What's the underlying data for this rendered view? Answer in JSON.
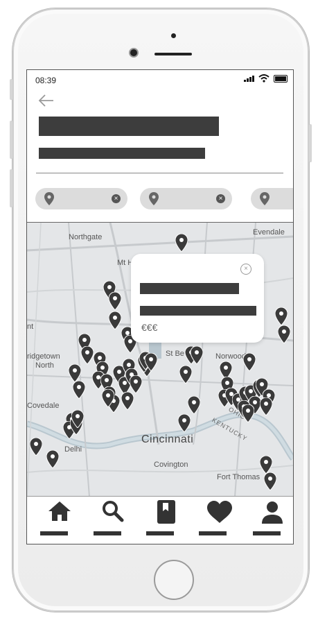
{
  "status_bar": {
    "time": "08:39"
  },
  "header": {
    "back_icon": "arrow-left-icon"
  },
  "filter_chips": [
    {
      "icon": "location-pin-icon",
      "remove_icon": "close-icon",
      "remove_symbol": "×"
    },
    {
      "icon": "location-pin-icon",
      "remove_icon": "close-icon",
      "remove_symbol": "×"
    },
    {
      "icon": "location-pin-icon"
    }
  ],
  "map": {
    "labels": {
      "northgate": "Northgate",
      "evendale": "Evendale",
      "mt_h": "Mt H",
      "nt": "nt",
      "bridgetown": "ridgetown",
      "north": "North",
      "st_be": "St Be",
      "norwood": "Norwood",
      "covedale": "Covedale",
      "ohio": "OHIO",
      "kentucky": "KENTUCKY",
      "cincinnati": "Cincinnati",
      "delhi": "Delhi",
      "covington": "Covington",
      "fort_thomas": "Fort Thomas"
    },
    "popup": {
      "price": "€€€",
      "close_icon": "close-circle-icon",
      "close_symbol": "×"
    }
  },
  "tab_bar": [
    {
      "name": "home",
      "icon": "home-icon"
    },
    {
      "name": "search",
      "icon": "search-icon"
    },
    {
      "name": "bookmarks",
      "icon": "bookmark-icon"
    },
    {
      "name": "favorites",
      "icon": "heart-icon"
    },
    {
      "name": "profile",
      "icon": "user-icon"
    }
  ]
}
